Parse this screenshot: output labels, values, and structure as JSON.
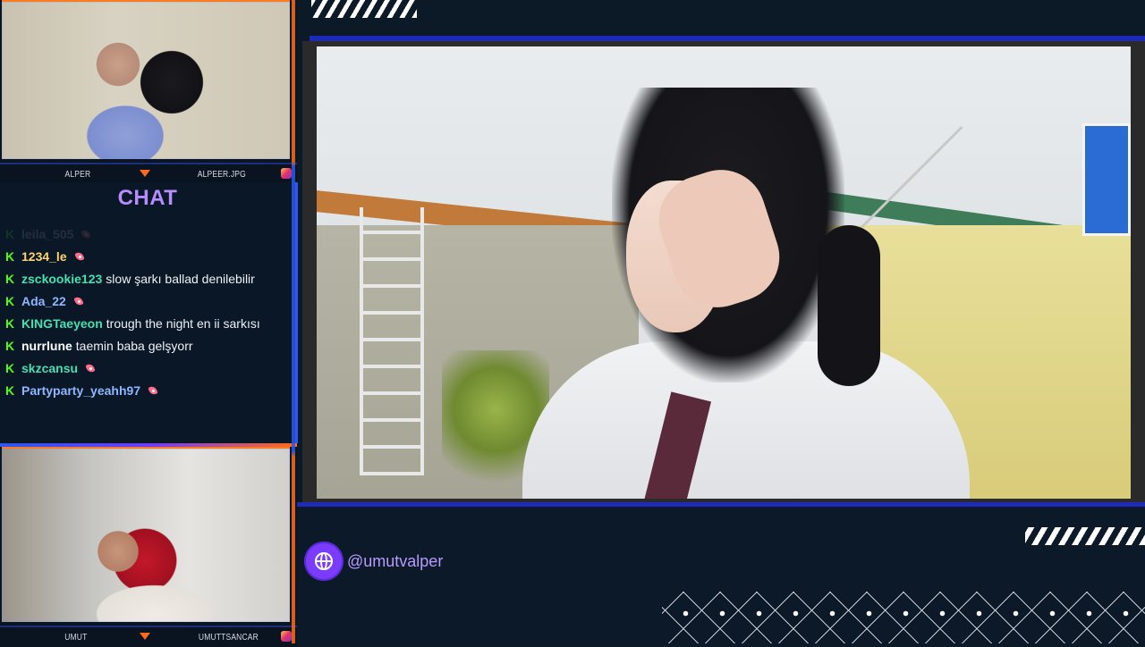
{
  "webcams": {
    "top": {
      "left_label": "ALPER",
      "right_label": "ALPEER.JPG"
    },
    "bottom": {
      "left_label": "UMUT",
      "right_label": "UMUTTSANCAR"
    }
  },
  "chat": {
    "title": "CHAT",
    "messages": [
      {
        "user": "leila_505",
        "text": "",
        "badge": true,
        "faded": true,
        "color": "#cfd6df"
      },
      {
        "user": "1234_le",
        "text": "",
        "badge": true,
        "color": "#ffd36b"
      },
      {
        "user": "zsckookie123",
        "text": "slow şarkı ballad denilebilir",
        "badge": false,
        "color": "#46e0b0"
      },
      {
        "user": "Ada_22",
        "text": "",
        "badge": true,
        "color": "#8fb6ff"
      },
      {
        "user": "KINGTaeyeon",
        "text": "trough the night en ii sarkısı",
        "badge": false,
        "color": "#46e0b0"
      },
      {
        "user": "nurrlune",
        "text": "taemin baba gelşyorr",
        "badge": false,
        "color": "#ffffff"
      },
      {
        "user": "skzcansu",
        "text": "",
        "badge": true,
        "color": "#46e0b0"
      },
      {
        "user": "Partyparty_yeahh97",
        "text": "",
        "badge": true,
        "color": "#8fb6ff"
      }
    ]
  },
  "social": {
    "handle": "@umutvalper",
    "icon": "globe-icon"
  },
  "colors": {
    "accent_purple": "#b68cff",
    "accent_blue": "#2a58f0",
    "accent_orange": "#ff6a1a",
    "kick_green": "#53fc18"
  }
}
